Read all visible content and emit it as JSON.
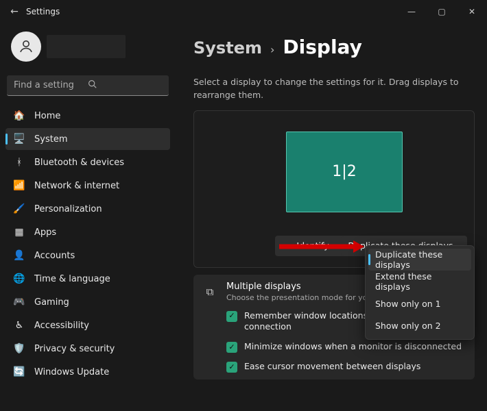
{
  "chrome": {
    "back_glyph": "←",
    "title": "Settings",
    "min": "—",
    "max": "▢",
    "close": "✕"
  },
  "sidebar": {
    "search_placeholder": "Find a setting",
    "items": [
      {
        "icon": "🏠",
        "label": "Home"
      },
      {
        "icon": "🖥️",
        "label": "System"
      },
      {
        "icon": "ᚼ",
        "label": "Bluetooth & devices"
      },
      {
        "icon": "📶",
        "label": "Network & internet"
      },
      {
        "icon": "🖌️",
        "label": "Personalization"
      },
      {
        "icon": "▦",
        "label": "Apps"
      },
      {
        "icon": "👤",
        "label": "Accounts"
      },
      {
        "icon": "🌐",
        "label": "Time & language"
      },
      {
        "icon": "🎮",
        "label": "Gaming"
      },
      {
        "icon": "♿",
        "label": "Accessibility"
      },
      {
        "icon": "🛡️",
        "label": "Privacy & security"
      },
      {
        "icon": "🔄",
        "label": "Windows Update"
      }
    ],
    "selected_index": 1
  },
  "breadcrumb": {
    "parent": "System",
    "sep": "›",
    "current": "Display"
  },
  "description": "Select a display to change the settings for it. Drag displays to rearrange them.",
  "arranger": {
    "tile_label": "1|2",
    "identify_label": "Identify",
    "mode_selected": "Duplicate these displays"
  },
  "mode_menu": [
    "Duplicate these displays",
    "Extend these displays",
    "Show only on 1",
    "Show only on 2"
  ],
  "multi": {
    "title": "Multiple displays",
    "subtitle": "Choose the presentation mode for your displays",
    "check1": "Remember window locations based on monitor connection",
    "check2": "Minimize windows when a monitor is disconnected",
    "check3": "Ease cursor movement between displays"
  }
}
